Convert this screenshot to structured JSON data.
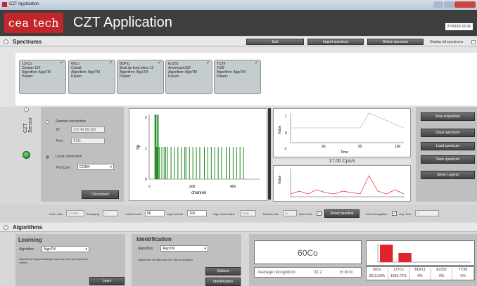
{
  "window": {
    "title": "CZT Application"
  },
  "header": {
    "logo": "cea tech",
    "title": "CZT Application",
    "date": "27/03/15 15:36"
  },
  "spectrums": {
    "section_label": "Spectrums",
    "sort_label": "Sort",
    "import_label": "Import spectrum",
    "delete_label": "Delete spectrum",
    "display_all_label": "Display all spectrums",
    "cards": [
      {
        "title": "137Cs",
        "name": "Cesium 137",
        "algo": "Algorithm: AlgoTM",
        "param": "Param:"
      },
      {
        "title": "60Co",
        "name": "Cobalt",
        "algo": "Algorithm: AlgoTM",
        "param": "Param:"
      },
      {
        "title": "BDF11",
        "name": "Bruit de fond pièce 11",
        "algo": "Algorithm: AlgoTM",
        "param": "Param:"
      },
      {
        "title": "Eu152",
        "name": "Americium152",
        "algo": "Algorithm: AlgoTM",
        "param": "Param:"
      },
      {
        "title": "TC99",
        "name": "Tc99",
        "algo": "Algorithm: AlgoTM",
        "param": "Param:"
      }
    ]
  },
  "sensor": {
    "label": "CZT Sensor",
    "remote_label": "Remote connection",
    "ip_label": "IP",
    "ip_value": "172.43.58.199",
    "port_label": "Port",
    "port_value": "4141",
    "local_label": "Local connection",
    "portcom_label": "PortCom",
    "portcom_value": "COM4",
    "disconnect_label": "Disconnect"
  },
  "spectrum_plot": {
    "y_label": "Sp",
    "x_label": "channel",
    "y_ticks": [
      "2",
      "1",
      "0"
    ],
    "x_ticks": [
      "0",
      "200",
      "400"
    ]
  },
  "value_plot": {
    "y_label": "Value",
    "x_label": "Time",
    "y_ticks": [
      "1",
      "0",
      "-1"
    ],
    "x_ticks": [
      "90",
      "95",
      "100"
    ]
  },
  "rate_plot": {
    "title": "17.00 Cps/s",
    "y_label": "Value"
  },
  "side_buttons": {
    "stop": "Stop acquisition",
    "clear": "Clear spectrum",
    "load": "Load spectrum",
    "save": "Save spectrum",
    "legend": "Show Legend"
  },
  "settings": {
    "coef_gain_label": "Coef. Gain",
    "coef_gain_value": "5.77899",
    "averaging_label": "Averaging",
    "averaging_value": "1",
    "lower_label": "Lower bound",
    "lower_value": "86",
    "upper_label": "Upper bound",
    "upper_value": "100",
    "high_canal_label": "High Canal Value",
    "high_canal_value": "1000",
    "refresh_label": "Refresh rate",
    "refresh_value": "10",
    "autoreset_label": "Auto reset",
    "reset_baseline_label": "Reset baseline",
    "auto_recognition_label": "Auto Recognition",
    "acq_time_label": "Acq. Time",
    "acq_time_value": "1"
  },
  "algorithms": {
    "section_label": "Algorithms",
    "learning": {
      "title": "Learning",
      "algo_label": "Algorithm",
      "algo_value": "AlgoTM",
      "desc": "Algorithme d'apprentissage basé sur les k plus proches voisins",
      "button": "Learn"
    },
    "identification": {
      "title": "Identification",
      "algo_label": "Algorithm",
      "algo_value": "AlgoTM",
      "desc": "Algorithme de détection de Thierry Montagu",
      "options_button": "Options",
      "identify_button": "Identification"
    }
  },
  "result": {
    "isotope": "60Co",
    "avg_label": "Average recognition:",
    "avg_value": "32.2",
    "time": "15:36:00",
    "table_headers": [
      "60Co",
      "137Cs",
      "BDF11",
      "Eu152",
      "TC99"
    ],
    "table_values": [
      "3219.59%",
      "1693.72%",
      "0%",
      "0%",
      "0%"
    ]
  },
  "chart_data": [
    {
      "type": "bar",
      "title": "",
      "categories": [
        "60Co",
        "137Cs",
        "BDF11",
        "Eu152",
        "TC99"
      ],
      "values": [
        3219.59,
        1693.72,
        0,
        0,
        0
      ],
      "ylabel": "",
      "colors": {
        "bar": "#e2232a"
      }
    },
    {
      "type": "bar",
      "title": "",
      "xlabel": "channel",
      "ylabel": "Sp",
      "xlim": [
        0,
        480
      ],
      "ylim": [
        0,
        2
      ],
      "x": [
        25,
        28,
        30,
        32,
        35,
        38,
        40,
        45,
        55,
        65,
        72,
        80,
        95,
        110,
        125,
        140,
        155,
        160,
        175,
        190,
        205,
        220,
        240,
        255,
        270,
        285,
        300,
        315,
        335,
        350,
        365,
        380,
        395,
        410
      ],
      "values": [
        2,
        2,
        2,
        1,
        2,
        1,
        2,
        1,
        1,
        1,
        1,
        1,
        1,
        1,
        1,
        1,
        1,
        1,
        1,
        1,
        1,
        1,
        1,
        1,
        1,
        1,
        1,
        1,
        1,
        1,
        1,
        1,
        1,
        1
      ],
      "colors": {
        "bar": "#1f8a1f"
      }
    },
    {
      "type": "line",
      "title": "",
      "xlabel": "Time",
      "ylabel": "Value",
      "xlim": [
        87,
        100
      ],
      "ylim": [
        -1,
        1
      ],
      "series": [
        {
          "x": [
            87,
            95,
            96,
            100
          ],
          "values": [
            0,
            0,
            1,
            0
          ]
        }
      ]
    },
    {
      "type": "line",
      "title": "17.00 Cps/s",
      "ylabel": "Value",
      "xlim": [
        87,
        100
      ],
      "ylim": [
        0,
        20
      ],
      "series": [
        {
          "x": [
            87,
            88,
            89,
            90,
            91,
            92,
            93,
            94,
            95,
            96,
            97,
            98,
            99,
            100
          ],
          "values": [
            2,
            4,
            2,
            5,
            3,
            2,
            4,
            3,
            2,
            15,
            4,
            2,
            5,
            2
          ]
        }
      ]
    }
  ]
}
